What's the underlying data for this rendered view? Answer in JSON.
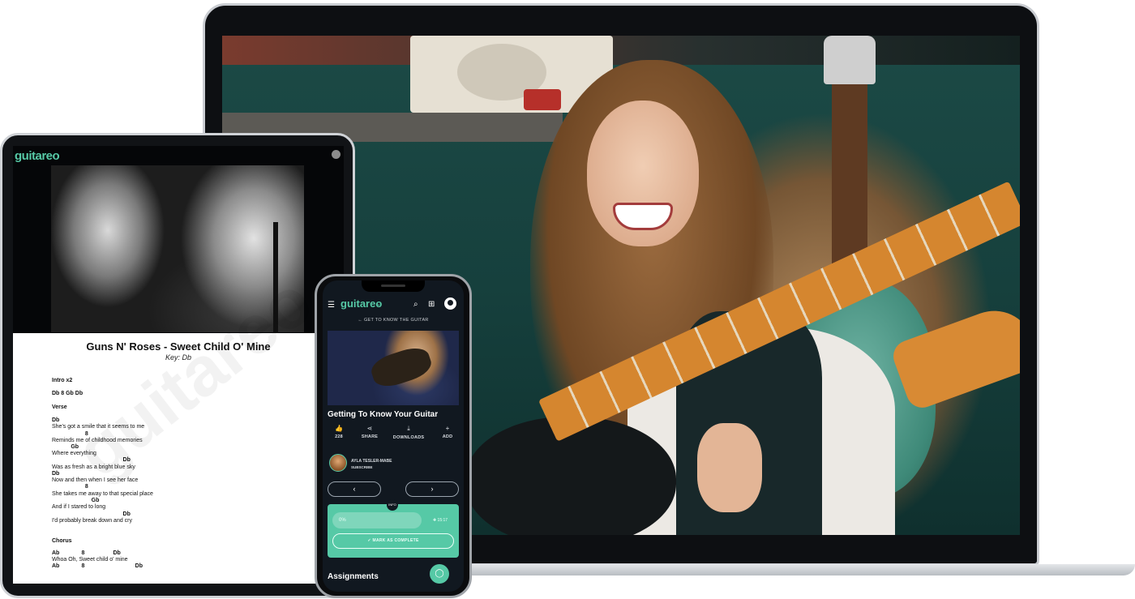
{
  "brand": {
    "name": "guitareo",
    "accent": "#56c9a6"
  },
  "tablet": {
    "logo": "guitareo",
    "watermark": "guitareo",
    "song_title": "Guns N' Roses - Sweet Child O' Mine",
    "song_key": "Key: Db",
    "sheet_lines": [
      {
        "text": "Intro x2",
        "bold": true
      },
      {
        "text": "Db 8 Gb Db",
        "bold": true
      },
      {
        "text": "Verse",
        "bold": true
      },
      {
        "text": "Db",
        "bold": true
      },
      {
        "text": "She's got a smile that it seems to me",
        "bold": false
      },
      {
        "text": "                     8",
        "bold": true
      },
      {
        "text": "Reminds me of childhood memories",
        "bold": false
      },
      {
        "text": "            Gb",
        "bold": true
      },
      {
        "text": "Where everything",
        "bold": false
      },
      {
        "text": "                                             Db",
        "bold": true
      },
      {
        "text": "Was as fresh as a bright blue sky",
        "bold": false
      },
      {
        "text": "Db",
        "bold": true
      },
      {
        "text": "Now and then when I see her face",
        "bold": false
      },
      {
        "text": "                     8",
        "bold": true
      },
      {
        "text": "She takes me away to that special place",
        "bold": false
      },
      {
        "text": "                         Gb",
        "bold": true
      },
      {
        "text": "And if I stared to long",
        "bold": false
      },
      {
        "text": "                                             Db",
        "bold": true
      },
      {
        "text": "I'd probably break down and cry",
        "bold": false
      },
      {
        "text": "Chorus",
        "bold": true
      },
      {
        "text": "Ab              8                  Db",
        "bold": true
      },
      {
        "text": "Whoa Oh, Sweet child o' mine",
        "bold": false
      },
      {
        "text": "Ab              8                                Db",
        "bold": true
      }
    ]
  },
  "phone": {
    "menu_icon": "menu-icon",
    "logo": "guitareo",
    "back_link": "← GET TO KNOW THE GUITAR",
    "lesson_title": "Getting To Know Your Guitar",
    "actions": [
      {
        "icon": "thumbs-up-icon",
        "glyph": "👍",
        "label": "228"
      },
      {
        "icon": "share-icon",
        "glyph": "⋖",
        "label": "SHARE"
      },
      {
        "icon": "download-icon",
        "glyph": "⤓",
        "label": "DOWNLOADS"
      },
      {
        "icon": "plus-icon",
        "glyph": "+",
        "label": "ADD"
      }
    ],
    "instructor": {
      "name": "AYLA TESLER-MABE",
      "subscribe": "SUBSCRIBE"
    },
    "prev_glyph": "‹",
    "next_glyph": "›",
    "info_badge": "INFO",
    "progress": {
      "percent": 0,
      "label": "0%",
      "goal_label": "✚ 15:17"
    },
    "complete_label": "✓  MARK AS COMPLETE",
    "section_heading": "Assignments",
    "chat_glyph": "◯"
  }
}
